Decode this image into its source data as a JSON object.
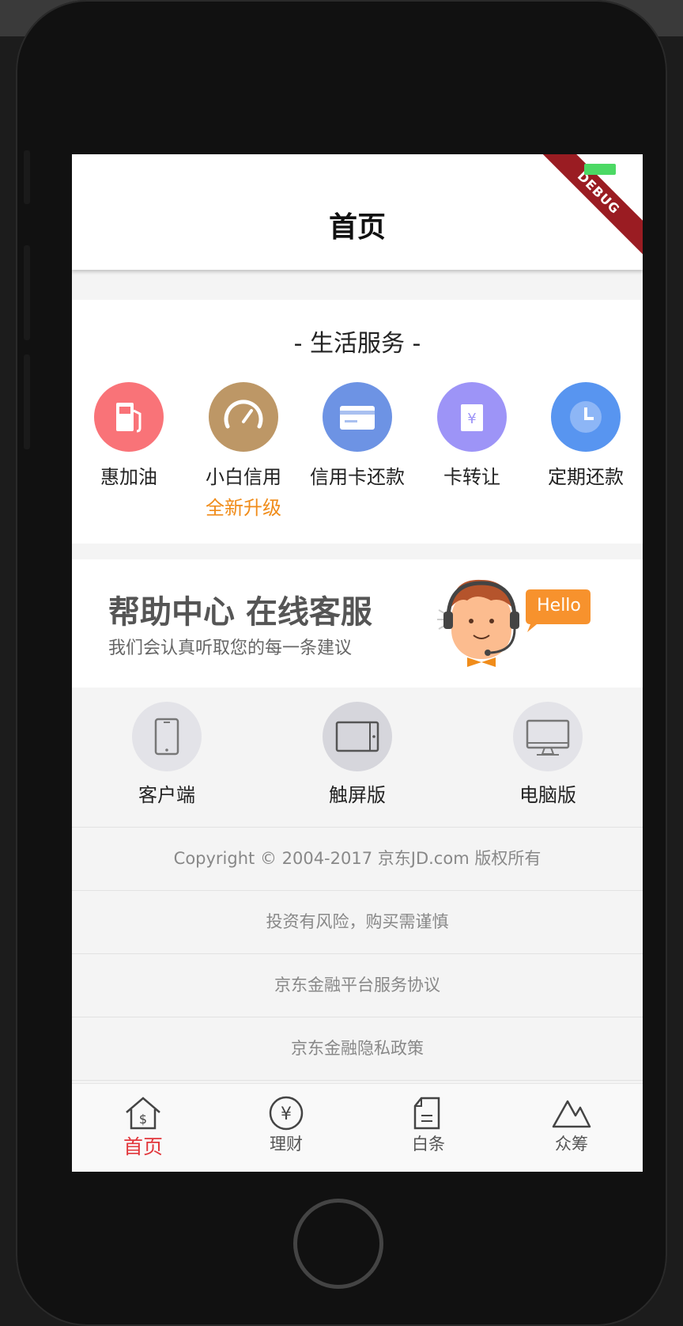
{
  "app": {
    "title": "首页",
    "debug_banner": "DEBUG"
  },
  "life_services": {
    "title": "- 生活服务 -",
    "items": [
      {
        "label": "惠加油",
        "icon": "gas-station-icon",
        "color": "#f97378"
      },
      {
        "label": "小白信用",
        "sub": "全新升级",
        "icon": "gauge-icon",
        "color": "#bd9766"
      },
      {
        "label": "信用卡还款",
        "icon": "credit-card-icon",
        "color": "#6d93e4"
      },
      {
        "label": "卡转让",
        "icon": "card-transfer-icon",
        "color": "#9d94f7"
      },
      {
        "label": "定期还款",
        "icon": "clock-icon",
        "color": "#5895f0"
      }
    ]
  },
  "help": {
    "title": "帮助中心 在线客服",
    "subtitle": "我们会认真听取您的每一条建议",
    "bubble": "Hello"
  },
  "devices": [
    {
      "label": "客户端",
      "icon": "phone-icon"
    },
    {
      "label": "触屏版",
      "icon": "tablet-icon"
    },
    {
      "label": "电脑版",
      "icon": "monitor-icon"
    }
  ],
  "footer": {
    "copyright": "Copyright © 2004-2017 京东JD.com 版权所有",
    "risk": "投资有风险，购买需谨慎",
    "agreement": "京东金融平台服务协议",
    "privacy": "京东金融隐私政策"
  },
  "tabs": [
    {
      "label": "首页",
      "icon": "home-icon",
      "active": true
    },
    {
      "label": "理财",
      "icon": "yen-coin-icon",
      "active": false
    },
    {
      "label": "白条",
      "icon": "document-icon",
      "active": false
    },
    {
      "label": "众筹",
      "icon": "mountain-icon",
      "active": false
    }
  ],
  "colors": {
    "accent": "#e2363b",
    "orange": "#f08c1a"
  }
}
